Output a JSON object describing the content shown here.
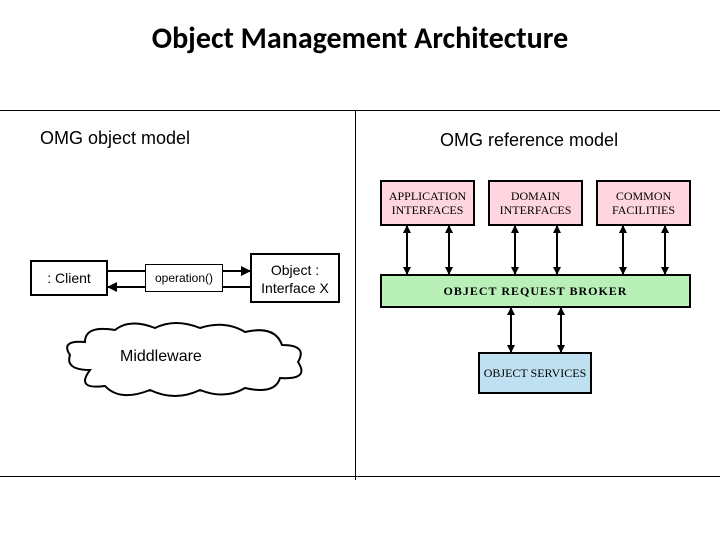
{
  "title": "Object Management Architecture",
  "left": {
    "heading": "OMG object model",
    "client": ": Client",
    "operation": "operation()",
    "interface_line1": "Object :",
    "interface_line2": "Interface X",
    "middleware": "Middleware"
  },
  "right": {
    "heading": "OMG reference model",
    "top_boxes": [
      {
        "label": "APPLICATION INTERFACES"
      },
      {
        "label": "DOMAIN INTERFACES"
      },
      {
        "label": "COMMON FACILITIES"
      }
    ],
    "orb": "OBJECT  REQUEST  BROKER",
    "services": "OBJECT SERVICES"
  },
  "colors": {
    "pink": "#ffd6e0",
    "green": "#b8f0b8",
    "blue": "#bfe0f0"
  }
}
